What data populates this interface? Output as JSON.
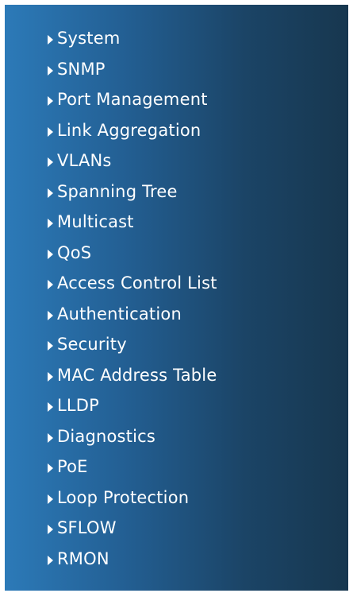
{
  "menu": {
    "items": [
      {
        "label": "System",
        "icon": "triangle-right-icon"
      },
      {
        "label": "SNMP",
        "icon": "triangle-right-icon"
      },
      {
        "label": "Port Management",
        "icon": "triangle-right-icon"
      },
      {
        "label": "Link Aggregation",
        "icon": "triangle-right-icon"
      },
      {
        "label": "VLANs",
        "icon": "triangle-right-icon"
      },
      {
        "label": "Spanning Tree",
        "icon": "triangle-right-icon"
      },
      {
        "label": "Multicast",
        "icon": "triangle-right-icon"
      },
      {
        "label": "QoS",
        "icon": "triangle-right-icon"
      },
      {
        "label": "Access Control List",
        "icon": "triangle-right-icon"
      },
      {
        "label": "Authentication",
        "icon": "triangle-right-icon"
      },
      {
        "label": "Security",
        "icon": "triangle-right-icon"
      },
      {
        "label": "MAC Address Table",
        "icon": "triangle-right-icon"
      },
      {
        "label": "LLDP",
        "icon": "triangle-right-icon"
      },
      {
        "label": "Diagnostics",
        "icon": "triangle-right-icon"
      },
      {
        "label": "PoE",
        "icon": "triangle-right-icon"
      },
      {
        "label": "Loop Protection",
        "icon": "triangle-right-icon"
      },
      {
        "label": "SFLOW",
        "icon": "triangle-right-icon"
      },
      {
        "label": "RMON",
        "icon": "triangle-right-icon"
      }
    ]
  },
  "colors": {
    "panel_gradient_start": "#2c7ab8",
    "panel_gradient_end": "#17374f",
    "text": "#ffffff"
  }
}
